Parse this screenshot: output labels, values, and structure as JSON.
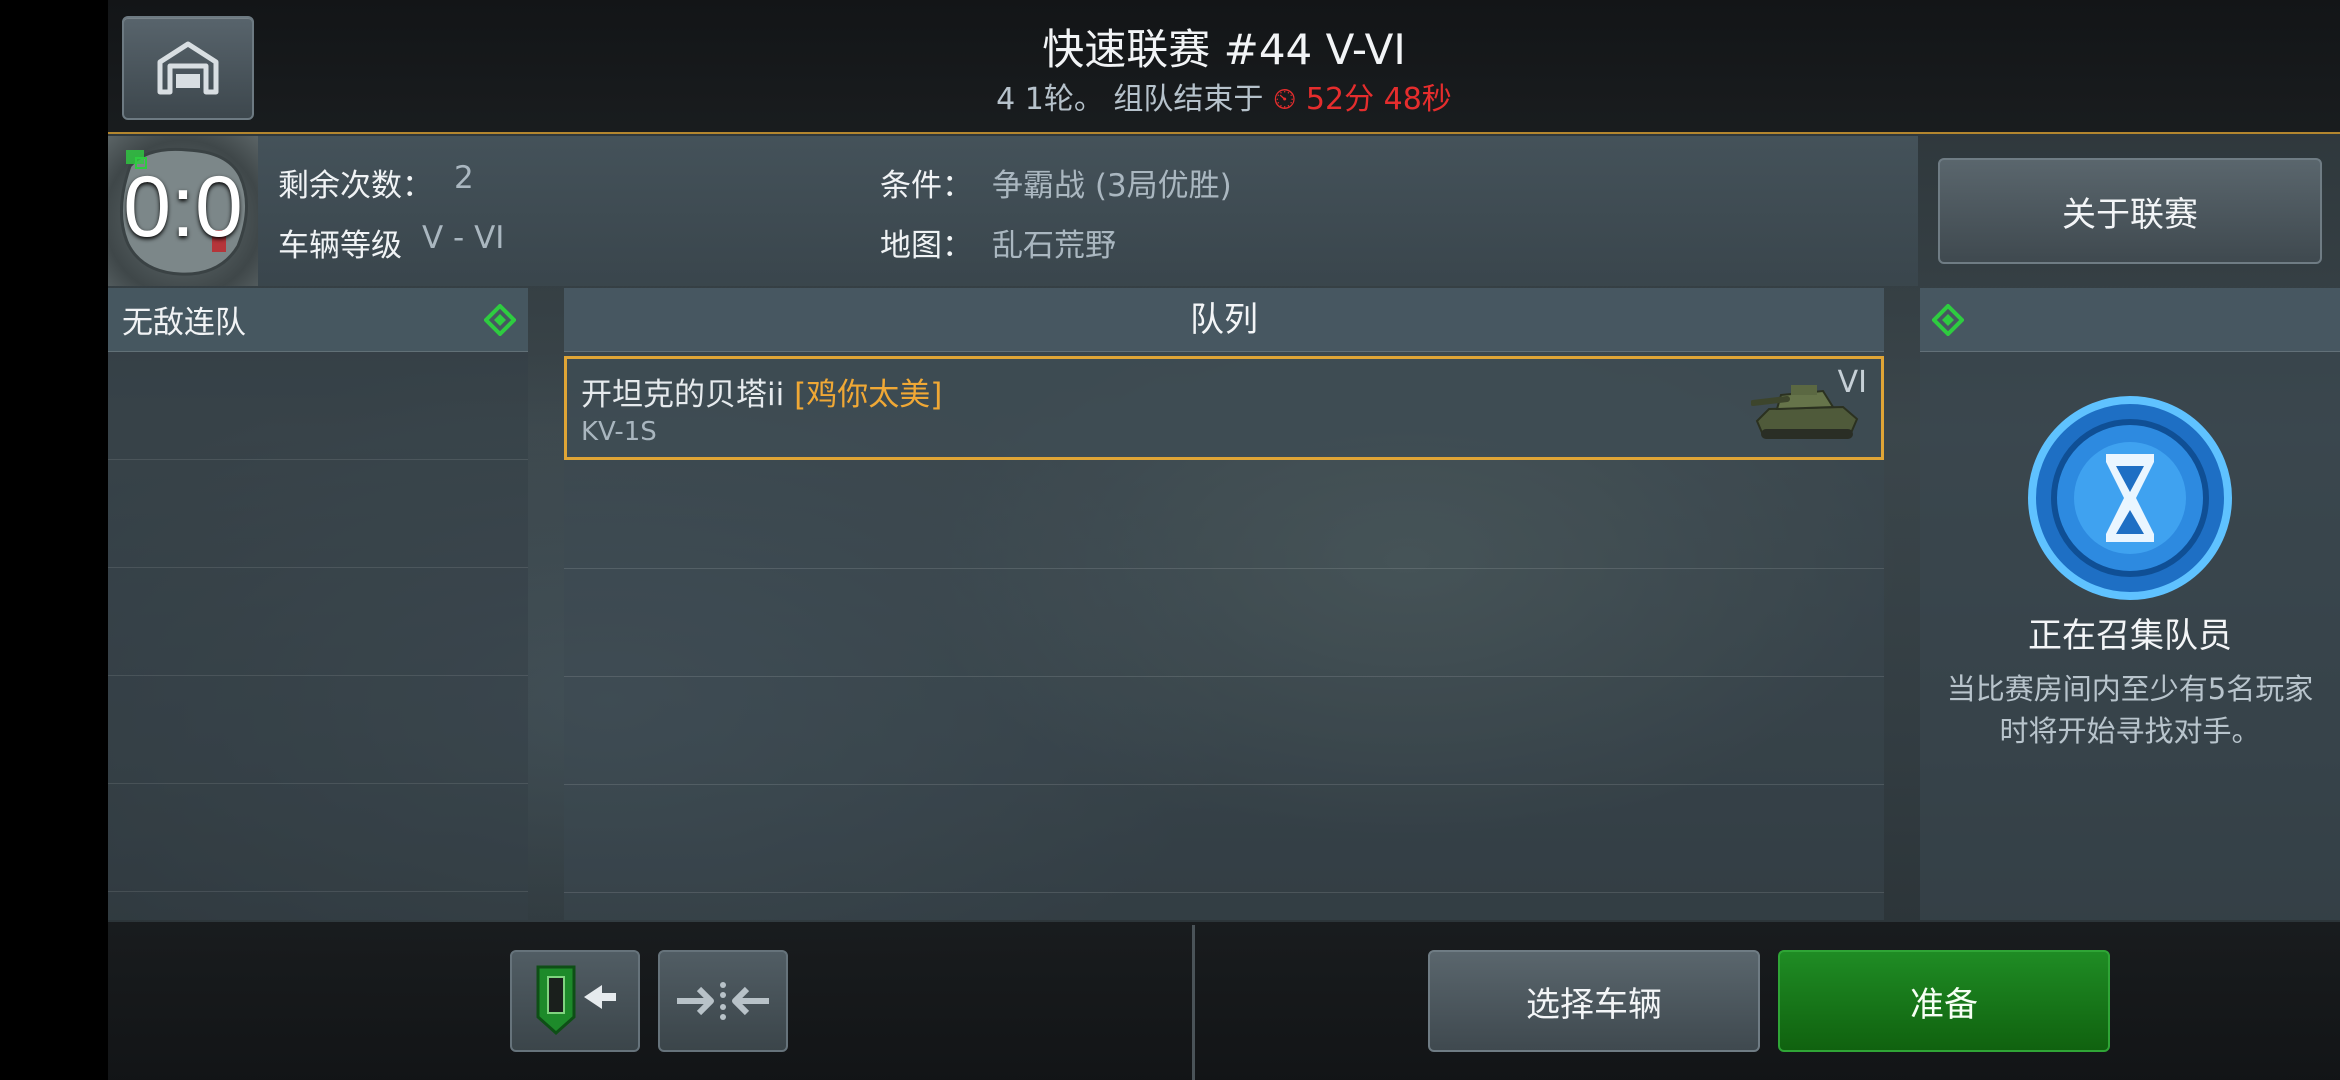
{
  "header": {
    "title": "快速联赛 #44 V-VI",
    "rounds_text": "4 1轮。 组队结束于",
    "timer_icon": "timer-icon",
    "timer": "52分 48秒"
  },
  "info": {
    "score": "0:0",
    "remaining_label": "剩余次数：",
    "remaining_value": "2",
    "tier_label": "车辆等级",
    "tier_value": "V - VI",
    "condition_label": "条件：",
    "condition_value": "争霸战 (3局优胜)",
    "map_label": "地图：",
    "map_value": "乱石荒野"
  },
  "about_button": "关于联赛",
  "left_panel": {
    "title": "无敌连队",
    "slots": 5
  },
  "queue": {
    "title": "队列",
    "entries": [
      {
        "player": "开坦克的贝塔ii",
        "clan": "[鸡你太美]",
        "tank": "KV-1S",
        "tier": "VI"
      }
    ]
  },
  "right_panel": {
    "status_title": "正在召集队员",
    "status_desc": "当比赛房间内至少有5名玩家时将开始寻找对手。"
  },
  "bottom": {
    "select_vehicle": "选择车辆",
    "ready": "准备"
  },
  "colors": {
    "accent_gold": "#e0a536",
    "timer_red": "#e52d2d",
    "ready_green": "#1f8c24",
    "diamond_green": "#2ecc40"
  }
}
